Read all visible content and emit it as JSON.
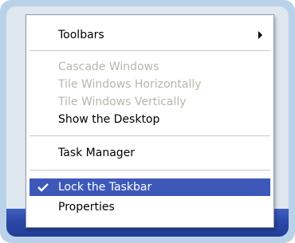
{
  "menu": {
    "items": [
      {
        "label": "Toolbars",
        "enabled": true,
        "submenu": true
      },
      {
        "label": "Cascade Windows",
        "enabled": false
      },
      {
        "label": "Tile Windows Horizontally",
        "enabled": false
      },
      {
        "label": "Tile Windows Vertically",
        "enabled": false
      },
      {
        "label": "Show the Desktop",
        "enabled": true
      },
      {
        "label": "Task Manager",
        "enabled": true
      },
      {
        "label": "Lock the Taskbar",
        "enabled": true,
        "checked": true,
        "highlighted": true
      },
      {
        "label": "Properties",
        "enabled": true
      }
    ]
  },
  "colors": {
    "frame": "#b9d2ea",
    "taskbar": "#2b49a8",
    "highlight": "#3d58b8",
    "disabled_text": "#b7b7a8"
  },
  "icons": {
    "submenu": "submenu-arrow-icon",
    "check": "checkmark-icon"
  }
}
